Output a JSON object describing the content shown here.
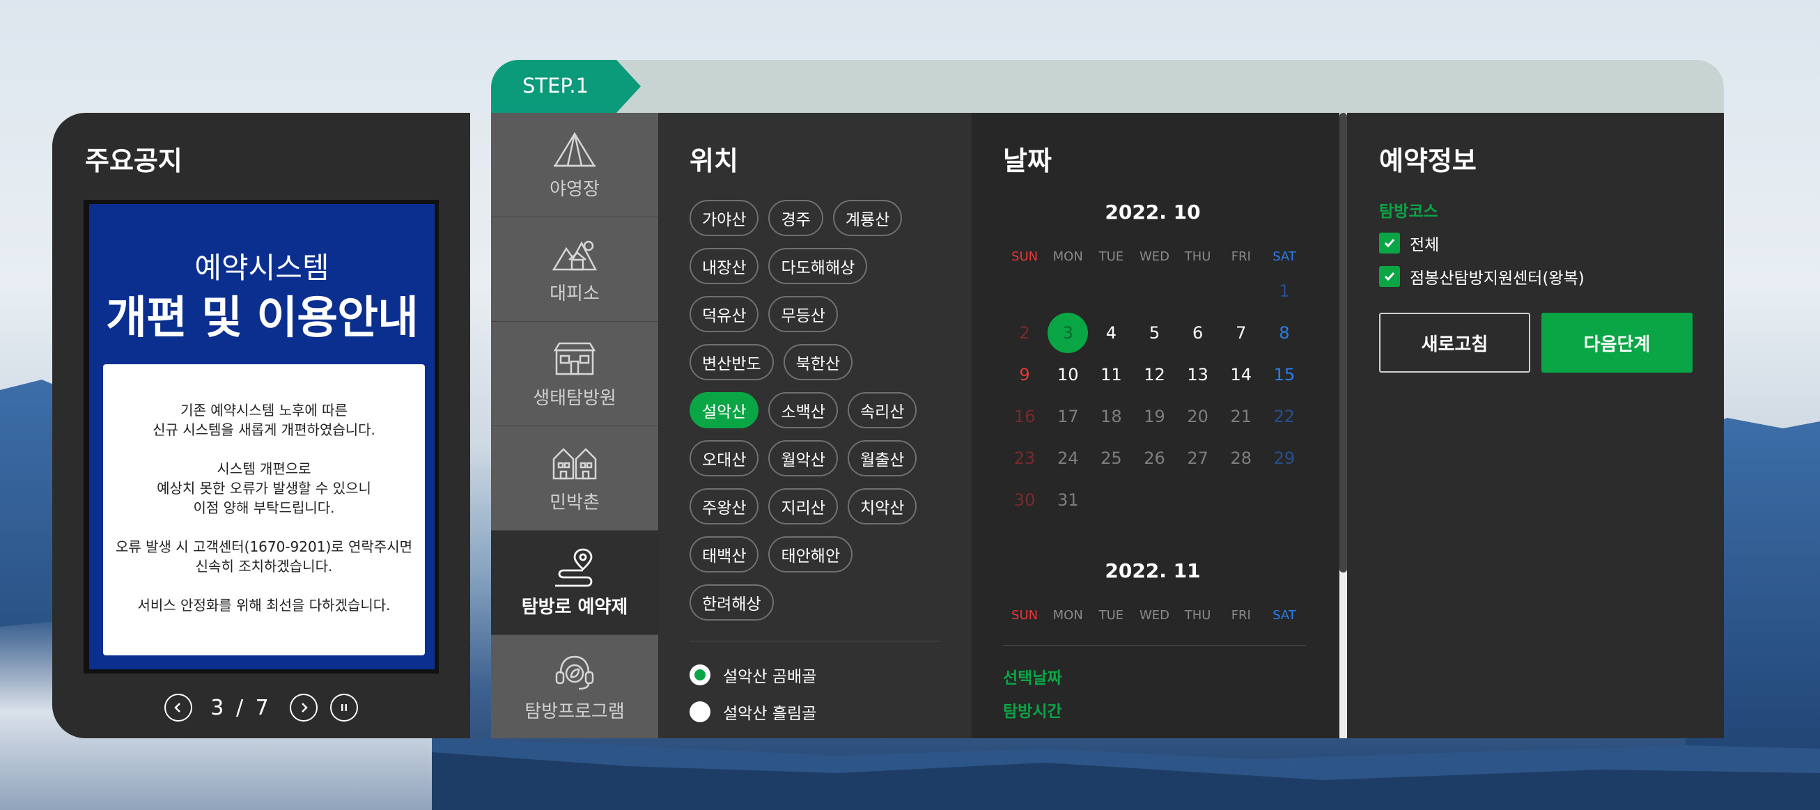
{
  "notice": {
    "title": "주요공지",
    "banner_subtitle": "예약시스템",
    "banner_title": "개편 및 이용안내",
    "banner_lines": [
      [
        "기존 예약시스템 노후에 따른",
        "신규 시스템을 새롭게 개편하였습니다."
      ],
      [
        "시스템 개편으로",
        "예상치 못한 오류가 발생할 수 있으니",
        "이점 양해 부탁드립니다."
      ],
      [
        "오류 발생 시 고객센터(1670-9201)로 연락주시면",
        "신속히 조치하겠습니다."
      ],
      [
        "서비스 안정화를 위해 최선을 다하겠습니다."
      ]
    ],
    "pager": {
      "current": "3",
      "separator": "/",
      "total": "7"
    }
  },
  "header": {
    "step_label": "STEP.1"
  },
  "side_nav": [
    {
      "label": "야영장",
      "icon": "tent-icon"
    },
    {
      "label": "대피소",
      "icon": "shelter-icon"
    },
    {
      "label": "생태탐방원",
      "icon": "eco-center-icon"
    },
    {
      "label": "민박촌",
      "icon": "houses-icon"
    },
    {
      "label": "탐방로 예약제",
      "icon": "trail-pin-icon",
      "active": true
    },
    {
      "label": "탐방프로그램",
      "icon": "guide-headset-icon"
    }
  ],
  "location": {
    "title": "위치",
    "chip_rows": [
      [
        "가야산",
        "경주",
        "계룡산"
      ],
      [
        "내장산",
        "다도해해상"
      ],
      [
        "덕유산",
        "무등산"
      ],
      [
        "변산반도",
        "북한산"
      ],
      [
        "설악산",
        "소백산",
        "속리산"
      ],
      [
        "오대산",
        "월악산",
        "월출산"
      ],
      [
        "주왕산",
        "지리산",
        "치악산"
      ],
      [
        "태백산",
        "태안해안"
      ],
      [
        "한려해상"
      ]
    ],
    "selected": "설악산",
    "trails": [
      {
        "label": "설악산 곰배골",
        "checked": true
      },
      {
        "label": "설악산 흘림골",
        "checked": false
      }
    ]
  },
  "date": {
    "title": "날짜",
    "weekdays": [
      "SUN",
      "MON",
      "TUE",
      "WED",
      "THU",
      "FRI",
      "SAT"
    ],
    "months": [
      {
        "title": "2022. 10",
        "weeks": [
          [
            "",
            "",
            "",
            "",
            "",
            "",
            "1"
          ],
          [
            "2",
            "3",
            "4",
            "5",
            "6",
            "7",
            "8"
          ],
          [
            "9",
            "10",
            "11",
            "12",
            "13",
            "14",
            "15"
          ],
          [
            "16",
            "17",
            "18",
            "19",
            "20",
            "21",
            "22"
          ],
          [
            "23",
            "24",
            "25",
            "26",
            "27",
            "28",
            "29"
          ],
          [
            "30",
            "31",
            "",
            "",
            "",
            "",
            ""
          ]
        ],
        "today": "3",
        "bookable": [
          "4",
          "5",
          "6",
          "7",
          "8",
          "9",
          "10",
          "11",
          "12",
          "13",
          "14",
          "15"
        ]
      },
      {
        "title": "2022. 11",
        "weeks": []
      }
    ],
    "selected_date_label": "선택날짜",
    "trail_time_label": "탐방시간"
  },
  "reservation": {
    "title": "예약정보",
    "course_label": "탐방코스",
    "checks": [
      {
        "label": "전체",
        "checked": true
      },
      {
        "label": "점봉산탐방지원센터(왕복)",
        "checked": true
      }
    ],
    "refresh_button": "새로고침",
    "next_button": "다음단계"
  },
  "colors": {
    "accent_green": "#0aa645",
    "step_badge": "#0b9a7a",
    "notice_banner": "#0a2f8f",
    "sunday": "#e8373b",
    "saturday": "#2b7de9"
  }
}
